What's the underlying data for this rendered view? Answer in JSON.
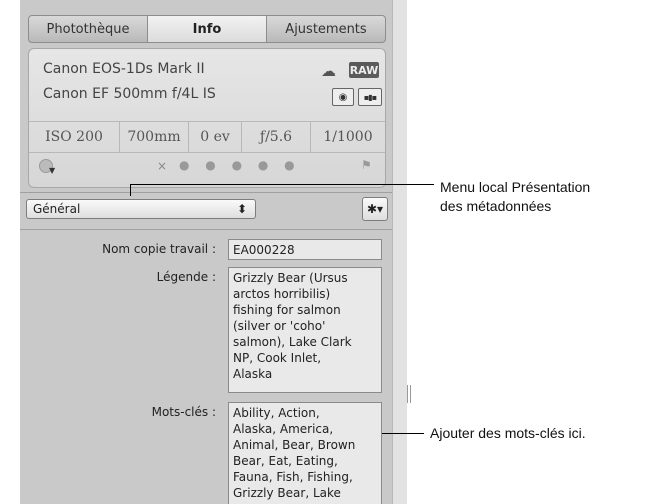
{
  "tabs": [
    "Photothèque",
    "Info",
    "Ajustements"
  ],
  "camera": {
    "model": "Canon EOS-1Ds Mark II",
    "lens": "Canon EF 500mm f/4L IS",
    "raw_badge": "RAW"
  },
  "exif": {
    "iso": "ISO 200",
    "focal": "700mm",
    "ev": "0 ev",
    "aperture": "ƒ/5.6",
    "shutter": "1/1000"
  },
  "rating": {
    "reject": "×",
    "stars": "● ● ● ● ●"
  },
  "metadata_view": {
    "selected": "Général"
  },
  "fields": {
    "version_label": "Nom copie travail :",
    "version_value": "EA000228",
    "caption_label": "Légende :",
    "caption_value": "Grizzly Bear (Ursus\narctos horribilis)\nfishing for salmon\n(silver or 'coho'\nsalmon), Lake Clark\nNP, Cook Inlet,\nAlaska",
    "keywords_label": "Mots-clés :",
    "keywords_value": "Ability, Action,\nAlaska, America,\nAnimal, Bear, Brown\nBear, Eat, Eating,\nFauna, Fish, Fishing,\nGrizzly Bear, Lake"
  },
  "callouts": {
    "menu": "Menu local Présentation\ndes métadonnées",
    "keywords": "Ajouter des mots-clés ici."
  }
}
